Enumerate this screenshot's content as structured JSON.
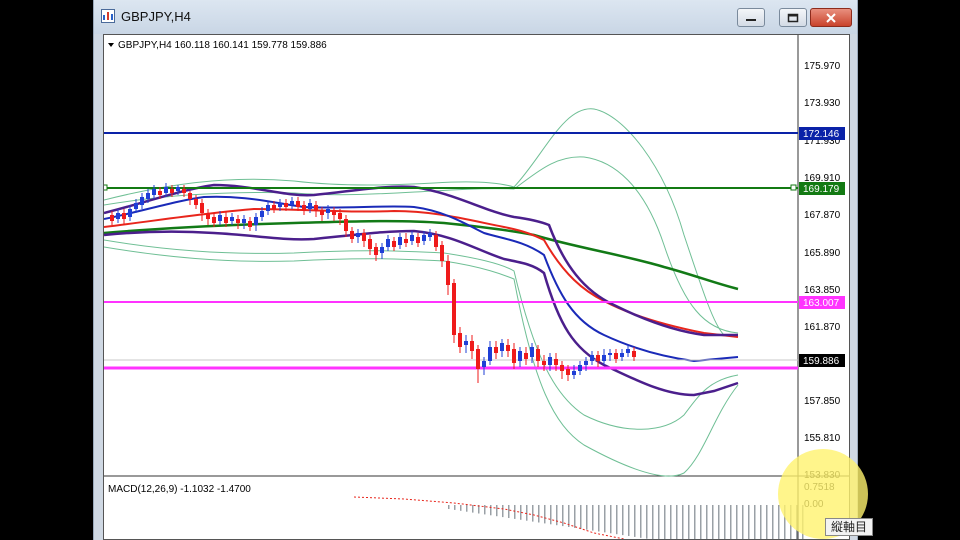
{
  "window": {
    "title": "GBPJPY,H4",
    "minimize_icon": "minimize-icon",
    "restore_icon": "restore-icon",
    "close_icon": "close-icon"
  },
  "chart": {
    "info_line": "GBPJPY,H4  160.118 160.141 159.778 159.886",
    "price_labels": [
      "175.970",
      "173.930",
      "171.930",
      "169.910",
      "167.870",
      "165.890",
      "163.850",
      "161.870",
      "157.850",
      "155.810",
      "153.830"
    ],
    "hlines": [
      {
        "label": "172.146",
        "color": "#0a22a8"
      },
      {
        "label": "169.179",
        "color": "#137a13"
      },
      {
        "label": "163.007",
        "color": "#ff33ff"
      },
      {
        "label": "159.886",
        "color": "#000000"
      }
    ],
    "colors": {
      "up": "#1f3fd6",
      "down": "#ef1b1b",
      "ma_red": "#e8261c",
      "ma_blue": "#1a2ab8",
      "ma_green": "#127a16",
      "ma_purple": "#4b1f8c",
      "band": "#6fbf95",
      "magenta": "#ff33ff"
    }
  },
  "macd": {
    "label": "MACD(12,26,9) -1.1032 -1.4700",
    "scale_labels": [
      "0.7518",
      "0.00"
    ]
  },
  "button": {
    "label": "縦軸目"
  }
}
